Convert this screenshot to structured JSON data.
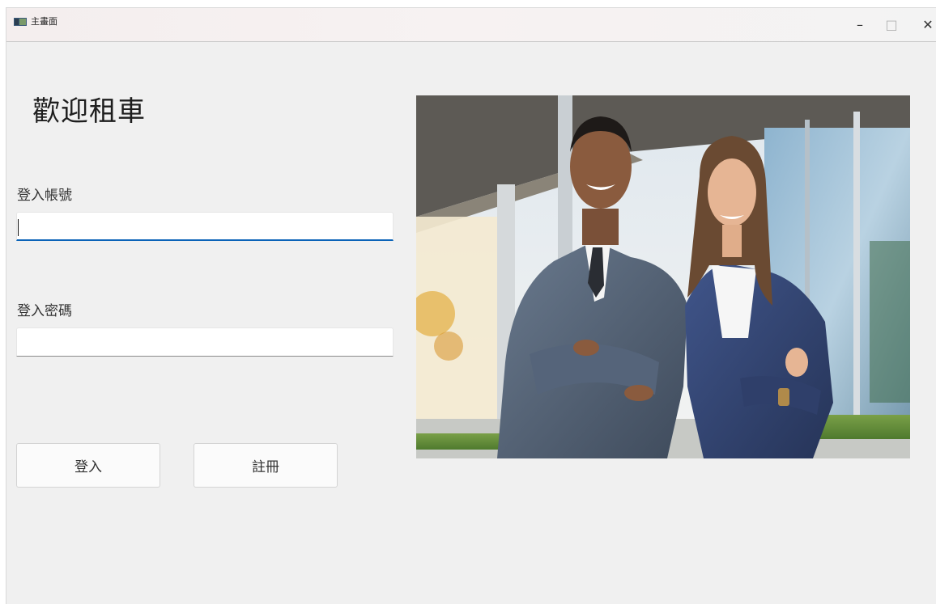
{
  "window": {
    "title": "主畫面",
    "controls": {
      "minimize": "–",
      "maximize": "□",
      "close": "✕"
    }
  },
  "main": {
    "heading": "歡迎租車",
    "username": {
      "label": "登入帳號",
      "value": "",
      "placeholder": ""
    },
    "password": {
      "label": "登入密碼",
      "value": "",
      "placeholder": ""
    },
    "buttons": {
      "login": "登入",
      "register": "註冊"
    }
  }
}
